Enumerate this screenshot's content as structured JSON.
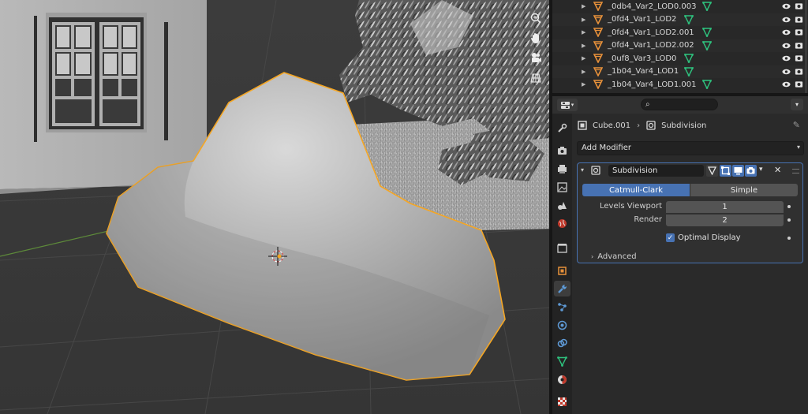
{
  "viewport": {
    "tools": [
      "zoom-icon",
      "hand-icon",
      "camera-icon",
      "grid-icon"
    ]
  },
  "outliner": {
    "rows": [
      {
        "name": "_0db4_Var2_LOD0.003"
      },
      {
        "name": "_0fd4_Var1_LOD2"
      },
      {
        "name": "_0fd4_Var1_LOD2.001"
      },
      {
        "name": "_0fd4_Var1_LOD2.002"
      },
      {
        "name": "_0uf8_Var3_LOD0"
      },
      {
        "name": "_1b04_Var4_LOD1"
      },
      {
        "name": "_1b04_Var4_LOD1.001"
      }
    ]
  },
  "properties": {
    "search_placeholder": "",
    "breadcrumb": {
      "object": "Cube.001",
      "separator": "›",
      "modifier": "Subdivision"
    },
    "add_modifier_label": "Add Modifier",
    "modifier": {
      "name": "Subdivision",
      "mode_options": [
        "Catmull-Clark",
        "Simple"
      ],
      "mode_selected": "Catmull-Clark",
      "levels_viewport_label": "Levels Viewport",
      "levels_viewport": "1",
      "render_label": "Render",
      "render": "2",
      "optimal_display_label": "Optimal Display",
      "optimal_display": true,
      "advanced_label": "Advanced"
    },
    "tabs": [
      "tool-icon",
      "render-icon",
      "output-icon",
      "view-layer-icon",
      "scene-icon",
      "world-icon",
      "collection-icon",
      "object-icon",
      "modifier-icon",
      "particles-icon",
      "physics-icon",
      "constraints-icon",
      "data-icon",
      "material-icon",
      "texture-icon"
    ]
  },
  "colors": {
    "selection_outline": "#f5a623",
    "accent": "#4772b3",
    "mesh_data": "#2ec27e",
    "mesh_object": "#e8913a"
  }
}
